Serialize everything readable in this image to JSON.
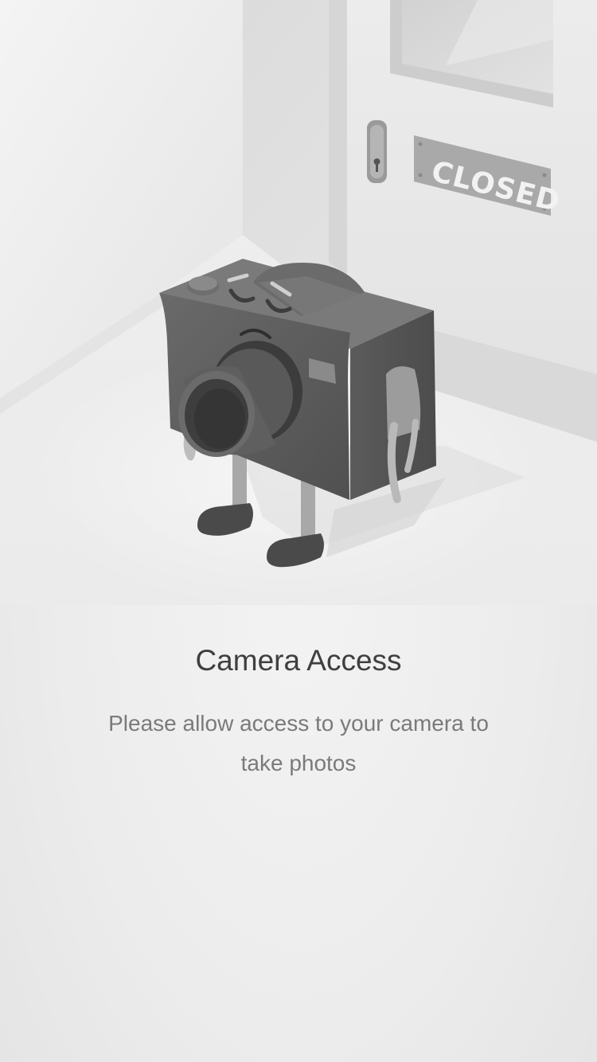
{
  "illustration": {
    "door_sign": "CLOSED",
    "icon": "camera-character-icon"
  },
  "permission": {
    "title": "Camera Access",
    "message": "Please allow access to your camera to take photos"
  }
}
